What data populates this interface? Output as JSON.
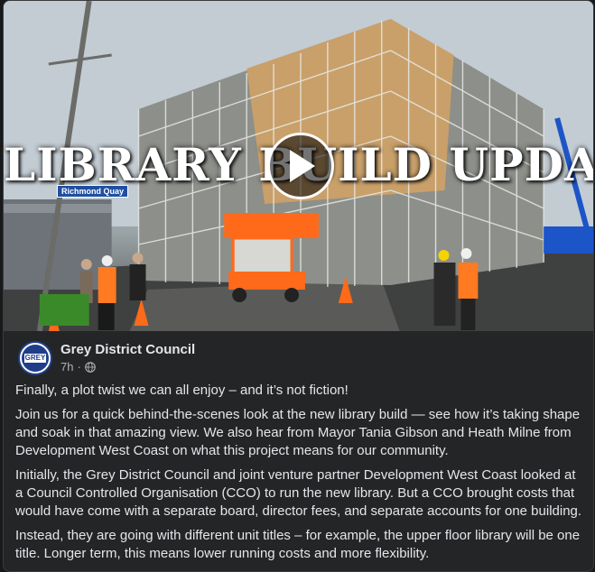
{
  "video": {
    "overlay_title": "LIBRARY BUILD UPDATE",
    "street_sign": "Richmond Quay"
  },
  "post": {
    "page_name": "Grey District Council",
    "avatar_text": "GREY",
    "time": "7h",
    "separator": "·",
    "privacy_icon": "globe-icon",
    "paragraphs": [
      "Finally, a plot twist we can all enjoy – and it’s not fiction!",
      "Join us for a quick behind-the-scenes look at the new library build — see how it’s taking shape and soak in that amazing view. We also hear from Mayor Tania Gibson and Heath Milne from Development West Coast on what this project means for our community.",
      "Initially, the Grey District Council and joint venture partner Development West Coast looked at a Council Controlled Organisation (CCO) to run the new library. But a CCO brought costs that would have come with a separate board, director fees, and separate accounts for one building.",
      "Instead, they are going with different unit titles – for example, the upper floor library will be one title. Longer term, this means lower running costs and more flexibility."
    ]
  },
  "colors": {
    "card_bg": "#242526",
    "text_primary": "#e4e6eb",
    "text_secondary": "#b0b3b8",
    "brand_blue": "#1f3e8a"
  }
}
